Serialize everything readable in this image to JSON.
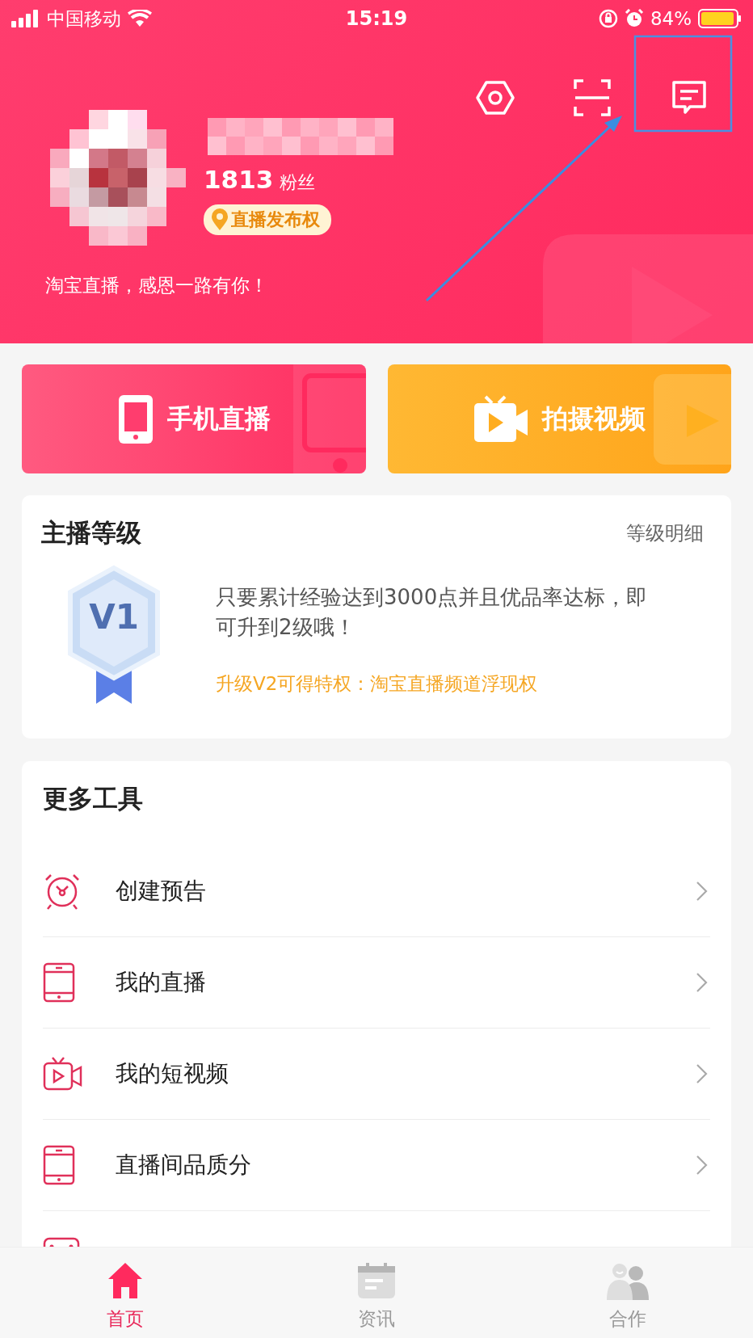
{
  "status_bar": {
    "carrier": "中国移动",
    "time": "15:19",
    "battery": "84%"
  },
  "header": {
    "fans_count": "1813",
    "fans_label": "粉丝",
    "badge": "直播发布权",
    "slogan": "淘宝直播，感恩一路有你！"
  },
  "actions": [
    {
      "kind": "live",
      "label": "手机直播"
    },
    {
      "kind": "video",
      "label": "拍摄视频"
    }
  ],
  "level_card": {
    "title": "主播等级",
    "link": "等级明细",
    "badge": "V1",
    "description": "只要累计经验达到3000点并且优品率达标，即可升到2级哦！",
    "privilege": "升级V2可得特权：淘宝直播频道浮现权"
  },
  "tools": {
    "title": "更多工具",
    "items": [
      {
        "kind": "alarm",
        "label": "创建预告"
      },
      {
        "kind": "phone",
        "label": "我的直播"
      },
      {
        "kind": "video",
        "label": "我的短视频"
      },
      {
        "kind": "phone",
        "label": "直播间品质分"
      },
      {
        "kind": "box"
      }
    ]
  },
  "tab_bar": [
    {
      "kind": "home",
      "label": "首页",
      "selected": true
    },
    {
      "kind": "news",
      "label": "资讯",
      "selected": false
    },
    {
      "kind": "team",
      "label": "合作",
      "selected": false
    }
  ]
}
